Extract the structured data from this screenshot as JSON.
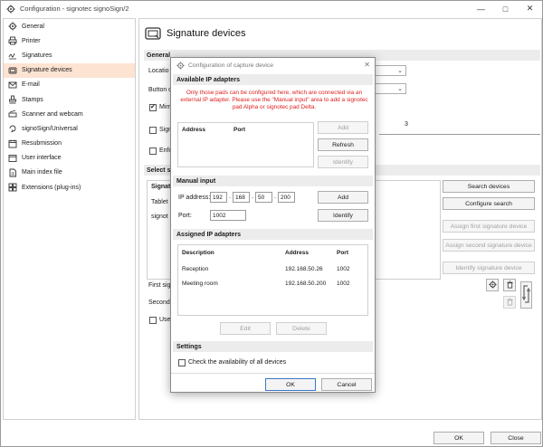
{
  "window": {
    "title": "Configuration - signotec signoSign/2",
    "min": "—",
    "max": "□",
    "close": "✕"
  },
  "sidebar": {
    "items": [
      {
        "label": "General",
        "icon": "gear-icon"
      },
      {
        "label": "Printer",
        "icon": "printer-icon"
      },
      {
        "label": "Signatures",
        "icon": "signature-icon"
      },
      {
        "label": "Signature devices",
        "icon": "signature-device-icon",
        "selected": true
      },
      {
        "label": "E-mail",
        "icon": "email-icon"
      },
      {
        "label": "Stamps",
        "icon": "stamp-icon"
      },
      {
        "label": "Scanner and webcam",
        "icon": "scanner-icon"
      },
      {
        "label": "signoSign/Universal",
        "icon": "universal-icon"
      },
      {
        "label": "Resubmission",
        "icon": "resubmission-icon"
      },
      {
        "label": "User interface",
        "icon": "user-interface-icon"
      },
      {
        "label": "Main index file",
        "icon": "index-file-icon"
      },
      {
        "label": "Extensions (plug-ins)",
        "icon": "extensions-icon"
      }
    ]
  },
  "content": {
    "title": "Signature devices",
    "general_head": "General",
    "location_label": "Locatio",
    "button_label": "Button o",
    "mirror_label": "Mirr",
    "sign_label": "Sign",
    "enforce_label": "Enfo",
    "value_3": "3",
    "select_head": "Select s",
    "signat_label": "Signat",
    "tablet_label": "Tablet",
    "signo_label": "signot",
    "first_sig_label": "First sig",
    "second_label": "Second",
    "use_label": "Use",
    "search_devices": "Search devices",
    "configure_search": "Configure search",
    "assign_first": "Assign first signature device",
    "assign_second": "Assign second signature device",
    "identify_device": "Identify signature device"
  },
  "footer": {
    "ok": "OK",
    "close": "Close"
  },
  "dialog": {
    "title": "Configuration of capture device",
    "available_head": "Available IP adapters",
    "warning": "Only those pads can be configured here, which are connected via an external IP adapter. Please use the \"Manual input\" area to add a signotec pad Alpha or signotec pad Delta.",
    "col_address": "Address",
    "col_port": "Port",
    "add": "Add",
    "refresh": "Refresh",
    "identify": "Identify",
    "manual_head": "Manual input",
    "ip_label": "IP address:",
    "ip": [
      "192",
      "168",
      "50",
      "200"
    ],
    "ip_dot": ".",
    "port_label": "Port:",
    "port_value": "1002",
    "manual_add": "Add",
    "manual_identify": "Identify",
    "assigned_head": "Assigned IP adapters",
    "col_description": "Description",
    "col_address2": "Address",
    "col_port2": "Port",
    "rows": [
      {
        "description": "Reception",
        "address": "192.168.50.26",
        "port": "1002"
      },
      {
        "description": "Meeting room",
        "address": "192.168.50.200",
        "port": "1002"
      }
    ],
    "edit": "Edit",
    "delete": "Delete",
    "settings_head": "Settings",
    "check_all": "Check the availability of all devices",
    "ok": "OK",
    "cancel": "Cancel"
  }
}
